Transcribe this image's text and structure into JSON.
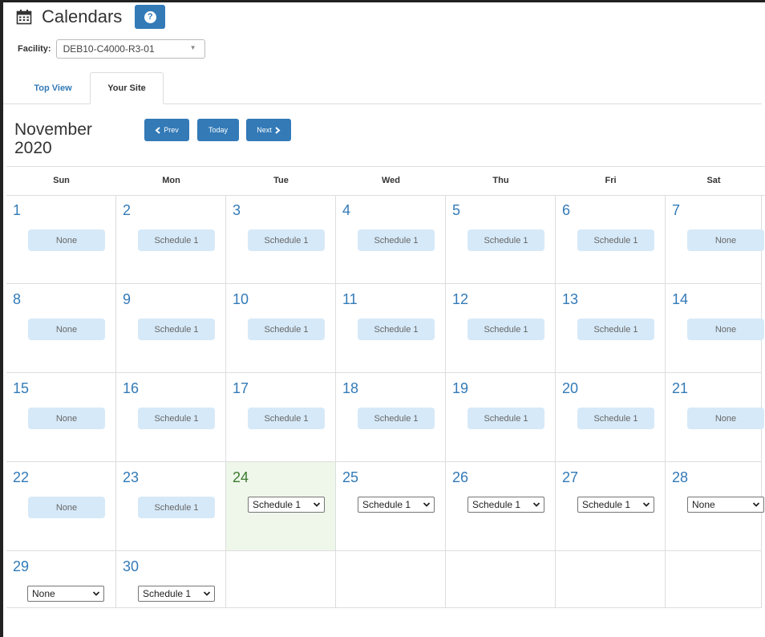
{
  "header": {
    "title": "Calendars",
    "icon": "calendar-icon",
    "help_label": "?"
  },
  "facility": {
    "label": "Facility:",
    "value": "DEB10-C4000-R3-01"
  },
  "tabs": [
    {
      "label": "Top View",
      "active": false
    },
    {
      "label": "Your Site",
      "active": true
    }
  ],
  "calendar_nav": {
    "month_label": "November 2020",
    "prev_label": "Prev",
    "today_label": "Today",
    "next_label": "Next"
  },
  "weekdays": [
    "Sun",
    "Mon",
    "Tue",
    "Wed",
    "Thu",
    "Fri",
    "Sat"
  ],
  "today_day": 24,
  "days": [
    {
      "day": "1",
      "schedule": "None",
      "mode": "label"
    },
    {
      "day": "2",
      "schedule": "Schedule 1",
      "mode": "label"
    },
    {
      "day": "3",
      "schedule": "Schedule 1",
      "mode": "label"
    },
    {
      "day": "4",
      "schedule": "Schedule 1",
      "mode": "label"
    },
    {
      "day": "5",
      "schedule": "Schedule 1",
      "mode": "label"
    },
    {
      "day": "6",
      "schedule": "Schedule 1",
      "mode": "label"
    },
    {
      "day": "7",
      "schedule": "None",
      "mode": "label"
    },
    {
      "day": "8",
      "schedule": "None",
      "mode": "label"
    },
    {
      "day": "9",
      "schedule": "Schedule 1",
      "mode": "label"
    },
    {
      "day": "10",
      "schedule": "Schedule 1",
      "mode": "label"
    },
    {
      "day": "11",
      "schedule": "Schedule 1",
      "mode": "label"
    },
    {
      "day": "12",
      "schedule": "Schedule 1",
      "mode": "label"
    },
    {
      "day": "13",
      "schedule": "Schedule 1",
      "mode": "label"
    },
    {
      "day": "14",
      "schedule": "None",
      "mode": "label"
    },
    {
      "day": "15",
      "schedule": "None",
      "mode": "label"
    },
    {
      "day": "16",
      "schedule": "Schedule 1",
      "mode": "label"
    },
    {
      "day": "17",
      "schedule": "Schedule 1",
      "mode": "label"
    },
    {
      "day": "18",
      "schedule": "Schedule 1",
      "mode": "label"
    },
    {
      "day": "19",
      "schedule": "Schedule 1",
      "mode": "label"
    },
    {
      "day": "20",
      "schedule": "Schedule 1",
      "mode": "label"
    },
    {
      "day": "21",
      "schedule": "None",
      "mode": "label"
    },
    {
      "day": "22",
      "schedule": "None",
      "mode": "label"
    },
    {
      "day": "23",
      "schedule": "Schedule 1",
      "mode": "label"
    },
    {
      "day": "24",
      "schedule": "Schedule 1",
      "mode": "select"
    },
    {
      "day": "25",
      "schedule": "Schedule 1",
      "mode": "select"
    },
    {
      "day": "26",
      "schedule": "Schedule 1",
      "mode": "select"
    },
    {
      "day": "27",
      "schedule": "Schedule 1",
      "mode": "select"
    },
    {
      "day": "28",
      "schedule": "None",
      "mode": "select"
    },
    {
      "day": "29",
      "schedule": "None",
      "mode": "select"
    },
    {
      "day": "30",
      "schedule": "Schedule 1",
      "mode": "select"
    }
  ],
  "colors": {
    "accent": "#337ab7",
    "today_bg": "#eef7ea",
    "schedule_chip": "#d6e9f8"
  }
}
